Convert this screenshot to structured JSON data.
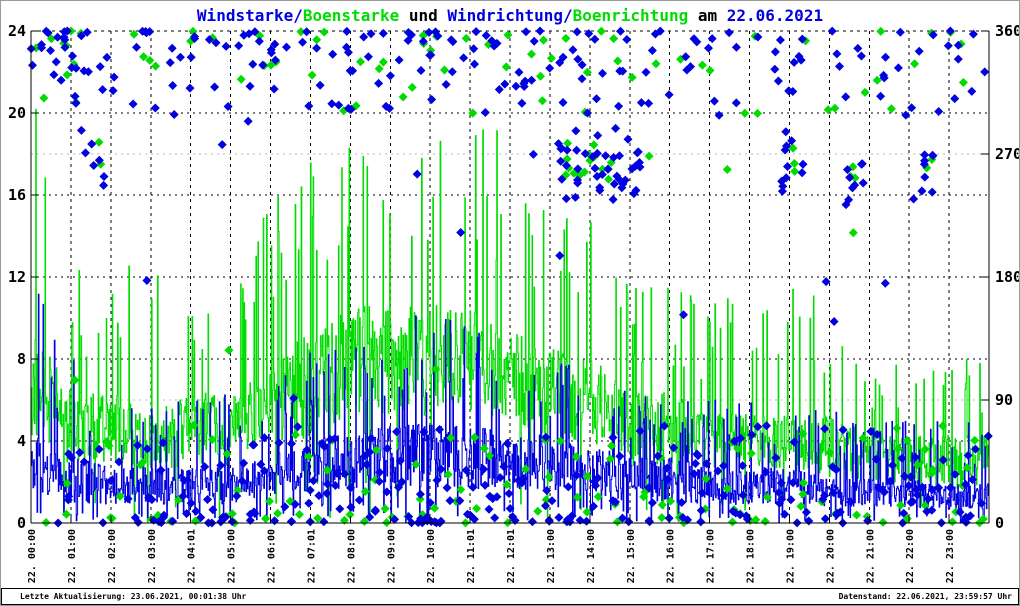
{
  "title": {
    "full": "Windstarke/Boenstarke und Windrichtung/Boenrichtung am 22.06.2021",
    "parts": [
      {
        "text": "Windstarke/",
        "color": "#0000e0"
      },
      {
        "text": "Boenstarke",
        "color": "#00dc00"
      },
      {
        "text": " und ",
        "color": "#000000"
      },
      {
        "text": "Windrichtung/",
        "color": "#0000e0"
      },
      {
        "text": "Boenrichtung",
        "color": "#00dc00"
      },
      {
        "text": " am ",
        "color": "#000000"
      },
      {
        "text": "22.06.2021",
        "color": "#0000e0"
      }
    ]
  },
  "footer": {
    "left": "Letzte Aktualisierung: 23.06.2021, 00:01:38 Uhr",
    "right": "Datenstand: 22.06.2021, 23:59:57 Uhr"
  },
  "colors": {
    "wind_blue": "#0000e0",
    "gust_green": "#00dc00",
    "grid_black": "#000000",
    "grid_gray": "#b8b8b8",
    "axis": "#000000",
    "background": "#ffffff"
  },
  "chart_data": {
    "type": "mixed",
    "title": "Windstarke/Boenstarke und Windrichtung/Boenrichtung am 22.06.2021",
    "grid": "dashed, vertical line each hour, horizontal at left ticks 4/8/12/16/20 (black) and right ticks 90/270 (gray)",
    "legend_position": "none (series identified by title colors)",
    "x_axis": {
      "range_hours": [
        0,
        24
      ],
      "tick_labels": [
        "22. 00:00",
        "22. 01:00",
        "22. 02:00",
        "22. 03:00",
        "22. 04:01",
        "22. 05:00",
        "22. 06:00",
        "22. 07:01",
        "22. 08:00",
        "22. 09:00",
        "22. 10:00",
        "22. 11:01",
        "22. 12:01",
        "22. 13:00",
        "22. 14:00",
        "22. 15:00",
        "22. 16:00",
        "22. 17:00",
        "22. 18:00",
        "22. 19:00",
        "22. 20:00",
        "22. 21:00",
        "22. 22:00",
        "22. 23:00"
      ]
    },
    "y_left": {
      "ticks": [
        0,
        4,
        8,
        12,
        16,
        20,
        24
      ],
      "range": [
        0,
        24
      ],
      "grid_at": [
        4,
        8,
        12,
        16,
        20
      ]
    },
    "y_right": {
      "ticks": [
        0,
        90,
        180,
        270,
        360
      ],
      "range": [
        0,
        360
      ],
      "gray_grid_at": [
        90,
        270
      ]
    },
    "series": [
      {
        "name": "Boenstarke",
        "type": "step-line",
        "axis": "left",
        "color": "#00dc00",
        "samples_per_hour": 60,
        "spike_probability": 0.1,
        "dip_probability": 0.03,
        "hourly_min": [
          3,
          2,
          2,
          2,
          2,
          2,
          3,
          3,
          4,
          4,
          4,
          4,
          4,
          3,
          3,
          2,
          2,
          2,
          2,
          2,
          1.5,
          1.5,
          1.5,
          1
        ],
        "hourly_typical": [
          9,
          6,
          6,
          5,
          6,
          6,
          7,
          9,
          10,
          10,
          10,
          10,
          9,
          8,
          8,
          6,
          6,
          5,
          5,
          5,
          5,
          4,
          4,
          4
        ],
        "hourly_max": [
          23,
          13,
          13,
          12.5,
          10,
          12.5,
          15.5,
          18,
          18.5,
          19,
          18.5,
          19.5,
          19,
          15,
          14.7,
          11.5,
          11.5,
          11,
          11.5,
          11.5,
          11.5,
          8,
          7.7,
          8
        ]
      },
      {
        "name": "Windstarke",
        "type": "step-line",
        "axis": "left",
        "color": "#0000e0",
        "samples_per_hour": 60,
        "spike_probability": 0.1,
        "dip_probability": 0.06,
        "hourly_min": [
          1,
          0.5,
          0.5,
          0.5,
          0.5,
          0.5,
          1,
          1,
          1,
          1,
          1,
          1,
          1,
          1,
          1,
          0.5,
          0.5,
          0.5,
          0.5,
          0.5,
          0.5,
          0.5,
          0.5,
          0.3
        ],
        "hourly_typical": [
          4,
          3,
          2.5,
          2.5,
          2.5,
          2.5,
          3,
          4,
          4,
          4.5,
          4.5,
          4.5,
          4,
          4,
          3.5,
          3,
          3,
          2.5,
          2.5,
          2.5,
          2,
          2,
          2,
          1.8
        ],
        "hourly_max": [
          12,
          8,
          7,
          6,
          6,
          6.5,
          7,
          8.5,
          9,
          10,
          10.5,
          9.5,
          8.5,
          8,
          7.5,
          6.5,
          6,
          6,
          6,
          6,
          5.5,
          5,
          5,
          5
        ]
      },
      {
        "name": "Windrichtung",
        "type": "scatter",
        "marker": "diamond",
        "axis": "right",
        "color": "#0000e0",
        "band_top_range": [
          298,
          360
        ],
        "band_bottom_range": [
          0,
          72
        ],
        "hourly_count_top": [
          16,
          12,
          8,
          7,
          8,
          8,
          9,
          10,
          9,
          9,
          9,
          10,
          11,
          10,
          8,
          7,
          6,
          6,
          6,
          5,
          6,
          7,
          5,
          7
        ],
        "hourly_count_bottom": [
          4,
          5,
          8,
          12,
          13,
          13,
          12,
          13,
          14,
          14,
          14,
          14,
          12,
          10,
          10,
          10,
          12,
          12,
          10,
          10,
          10,
          12,
          14,
          14
        ],
        "clusters": [
          [
            1.25,
            1.95,
            245,
            290,
            7
          ],
          [
            13.2,
            15.35,
            235,
            292,
            45
          ],
          [
            18.8,
            19.35,
            235,
            290,
            11
          ],
          [
            20.4,
            20.85,
            230,
            268,
            9
          ],
          [
            22.3,
            22.65,
            242,
            275,
            8
          ]
        ],
        "sparse_mid": {
          "per_hour_probability": 0.55,
          "dir_range": [
            70,
            300
          ]
        }
      },
      {
        "name": "Boenrichtung",
        "type": "scatter",
        "marker": "diamond",
        "axis": "right",
        "color": "#00dc00",
        "band_top_range": [
          298,
          360
        ],
        "band_bottom_range": [
          0,
          72
        ],
        "hourly_count_top": [
          6,
          4,
          3,
          2,
          3,
          3,
          3,
          4,
          4,
          4,
          4,
          4,
          4,
          4,
          3,
          2,
          2,
          2,
          2,
          2,
          2,
          3,
          2,
          3
        ],
        "hourly_count_bottom": [
          3,
          3,
          4,
          5,
          5,
          5,
          5,
          5,
          6,
          6,
          6,
          6,
          5,
          5,
          5,
          5,
          6,
          6,
          5,
          5,
          5,
          6,
          7,
          7
        ],
        "clusters": [
          [
            13.35,
            14.65,
            245,
            278,
            14
          ],
          [
            18.95,
            19.25,
            250,
            285,
            3
          ],
          [
            20.45,
            20.75,
            245,
            265,
            4
          ],
          [
            22.4,
            22.6,
            250,
            268,
            2
          ],
          [
            1.4,
            1.8,
            255,
            280,
            2
          ]
        ],
        "sparse_mid": {
          "per_hour_probability": 0.25,
          "dir_range": [
            80,
            300
          ]
        }
      }
    ]
  }
}
